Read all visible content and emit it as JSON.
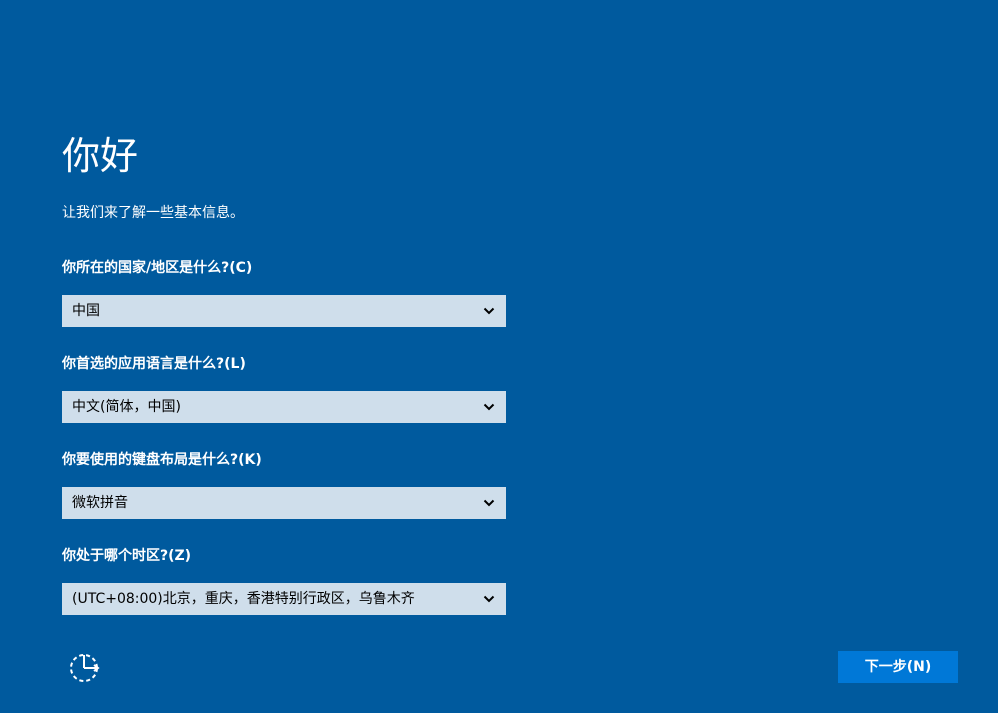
{
  "header": {
    "title": "你好",
    "subtitle": "让我们来了解一些基本信息。"
  },
  "questions": [
    {
      "label": "你所在的国家/地区是什么?(C)",
      "selected": "中国"
    },
    {
      "label": "你首选的应用语言是什么?(L)",
      "selected": "中文(简体，中国)"
    },
    {
      "label": "你要使用的键盘布局是什么?(K)",
      "selected": "微软拼音"
    },
    {
      "label": "你处于哪个时区?(Z)",
      "selected": "(UTC+08:00)北京，重庆，香港特别行政区，乌鲁木齐"
    }
  ],
  "footer": {
    "next_label": "下一步(N)",
    "accessibility_icon": "ease-of-access-icon"
  },
  "colors": {
    "background": "#005a9e",
    "dropdown_bg": "#cfdeeb",
    "button_bg": "#0078d7",
    "text": "#ffffff"
  }
}
